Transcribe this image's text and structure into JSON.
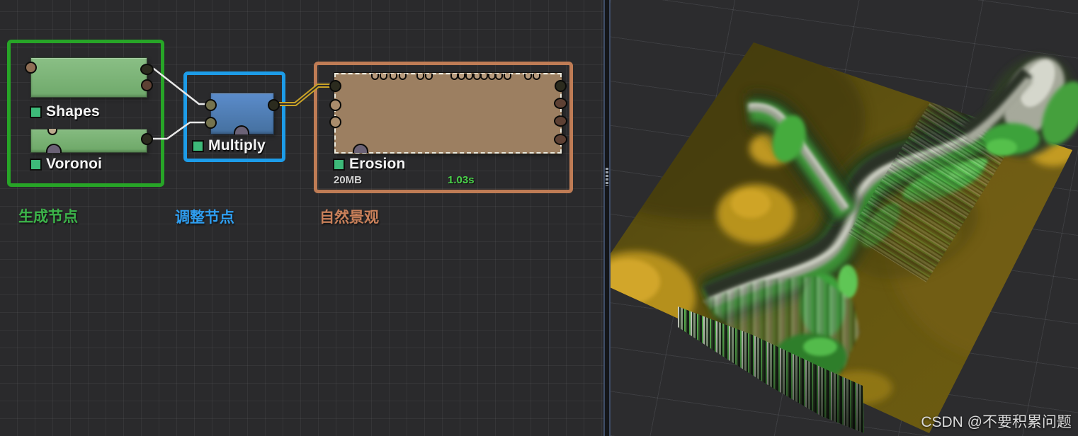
{
  "graph": {
    "groups": {
      "generate": {
        "label": "生成节点",
        "color": "#27a527"
      },
      "adjust": {
        "label": "调整节点",
        "color": "#1d9ce8"
      },
      "nature": {
        "label": "自然景观",
        "color": "#bf7c55"
      }
    },
    "nodes": {
      "shapes": {
        "label": "Shapes"
      },
      "voronoi": {
        "label": "Voronoi"
      },
      "multiply": {
        "label": "Multiply"
      },
      "erosion": {
        "label": "Erosion",
        "memory": "20MB",
        "build_time": "1.03s"
      }
    }
  },
  "colors": {
    "accent_chip": "#3dba79",
    "time_green": "#4ad34a",
    "wire_white": "#e8e8e8",
    "wire_gold": "#c9a227",
    "node_green": "#7cb377",
    "node_blue": "#4f7cb5",
    "node_tan": "#9c7f61"
  },
  "preview": {
    "watermark": "CSDN @不要积累问题"
  }
}
